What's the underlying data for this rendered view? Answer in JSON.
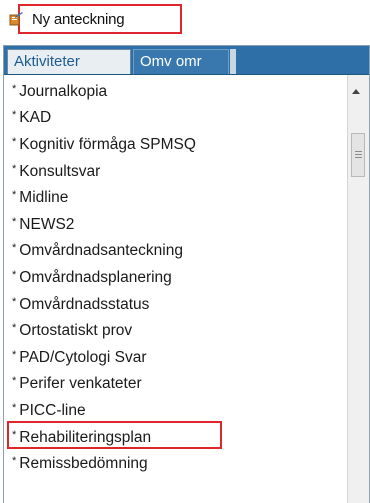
{
  "header": {
    "new_note_label": "Ny anteckning"
  },
  "tabs": [
    {
      "label": "Aktiviteter",
      "active": true
    },
    {
      "label": "Omv omr",
      "active": false
    }
  ],
  "list": {
    "items": [
      "Journalkopia",
      "KAD",
      "Kognitiv förmåga SPMSQ",
      "Konsultsvar",
      "Midline",
      "NEWS2",
      "Omvårdnadsanteckning",
      "Omvårdnadsplanering",
      "Omvårdnadsstatus",
      "Ortostatiskt prov",
      "PAD/Cytologi Svar",
      "Perifer venkateter",
      "PICC-line",
      "Rehabiliteringsplan",
      "Remissbedömning"
    ],
    "bullet": "*",
    "highlighted_item": "Rehabiliteringsplan"
  },
  "colors": {
    "tab_strip": "#2d6fa6",
    "highlight_border": "#e0262d"
  }
}
